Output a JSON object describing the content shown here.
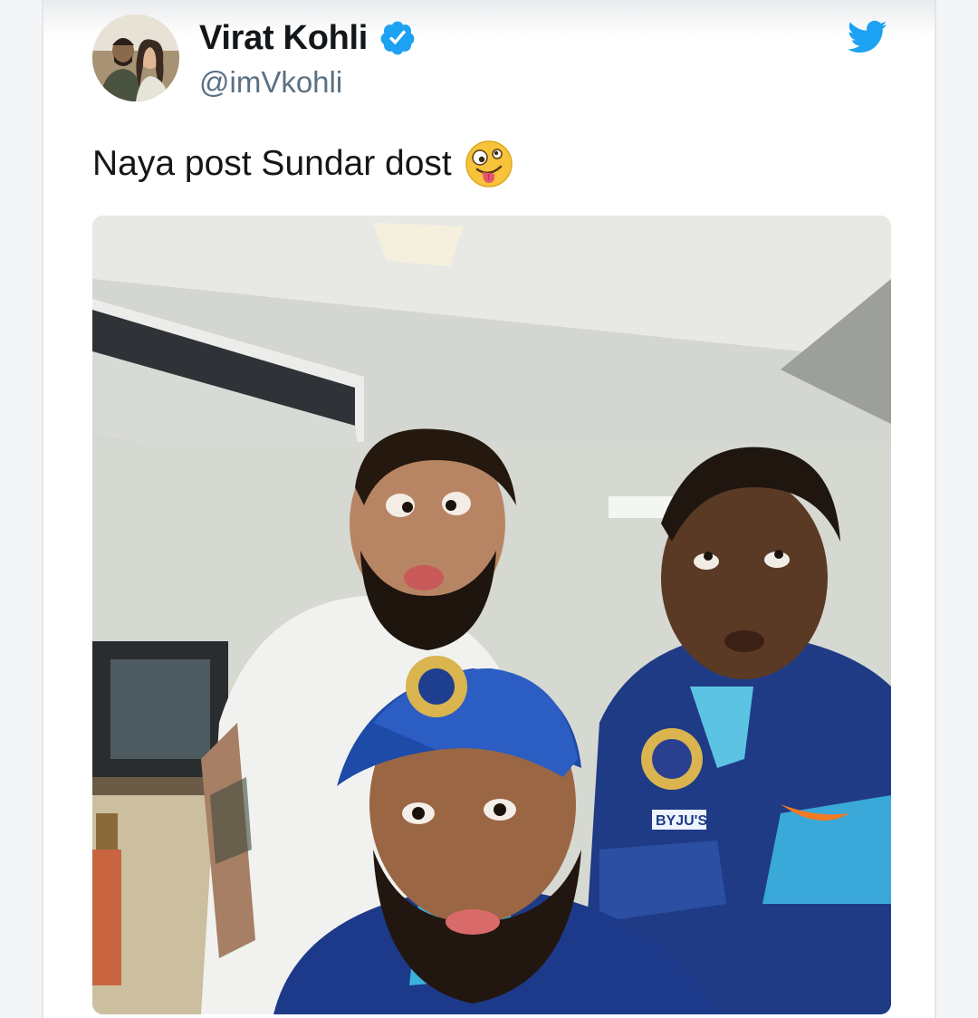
{
  "tweet": {
    "author_name": "Virat Kohli",
    "author_handle": "@imVkohli",
    "verified": true,
    "text": "Naya post Sundar dost",
    "text_emoji": "zany-face",
    "brand_color": "#1da1f2"
  },
  "icons": {
    "verified": "verified-badge-icon",
    "platform": "twitter-bird-icon"
  },
  "media": {
    "type": "photo"
  },
  "jersey": {
    "chest_text": "BYJU'S"
  }
}
